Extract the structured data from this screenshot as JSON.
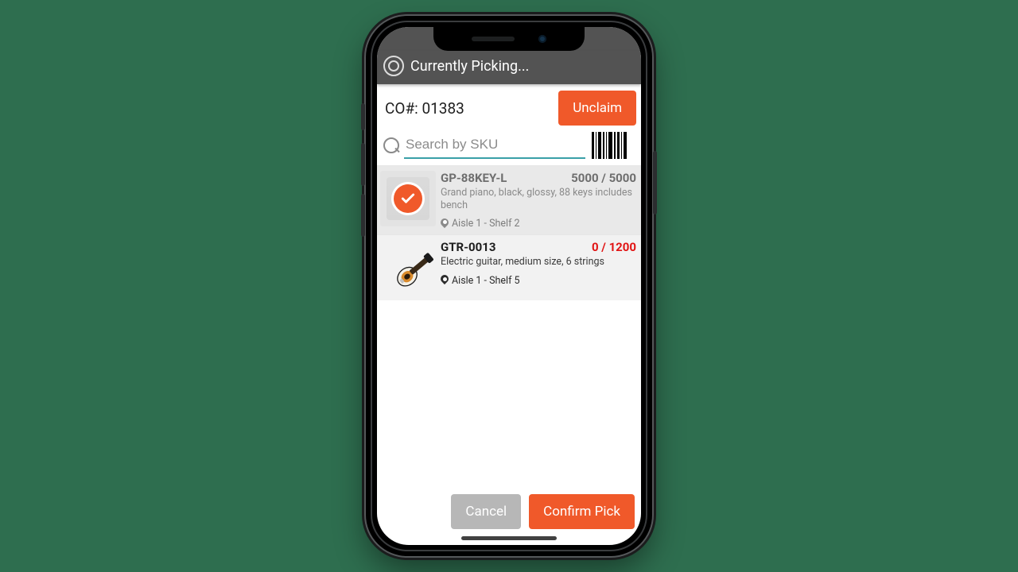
{
  "header": {
    "title": "Currently Picking..."
  },
  "order": {
    "label": "CO#: 01383",
    "unclaim": "Unclaim"
  },
  "search": {
    "placeholder": "Search by SKU",
    "value": ""
  },
  "items": [
    {
      "sku": "GP-88KEY-L",
      "qty": "5000 / 5000",
      "done": true,
      "desc": "Grand piano, black, glossy, 88 keys includes bench",
      "location": "Aisle 1 - Shelf 2"
    },
    {
      "sku": "GTR-0013",
      "qty": "0 / 1200",
      "done": false,
      "desc": "Electric guitar, medium size, 6 strings",
      "location": "Aisle 1 - Shelf 5"
    }
  ],
  "footer": {
    "cancel": "Cancel",
    "confirm": "Confirm Pick"
  }
}
